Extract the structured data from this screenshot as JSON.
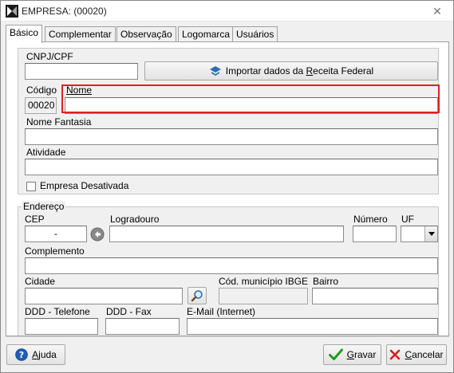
{
  "window": {
    "title": "EMPRESA: (00020)",
    "close_glyph": "✕"
  },
  "tabs": [
    {
      "label": "Básico",
      "active": true
    },
    {
      "label": "Complementar"
    },
    {
      "label": "Observação"
    },
    {
      "label": "Logomarca"
    },
    {
      "label": "Usuários"
    }
  ],
  "basic": {
    "cnpj_label": "CNPJ/CPF",
    "cnpj_value": "",
    "import_button": {
      "prefix": "Importar dados da ",
      "accel": "R",
      "suffix": "eceita Federal"
    },
    "codigo_label": "Código",
    "codigo_value": "00020",
    "nome_label": "Nome",
    "nome_value": "",
    "fantasia_label": "Nome Fantasia",
    "fantasia_value": "",
    "atividade_label": "Atividade",
    "atividade_value": "",
    "desativada_label": "Empresa Desativada",
    "desativada_checked": false
  },
  "address": {
    "legend": "Endereço",
    "cep_label": "CEP",
    "cep_value": "-",
    "logradouro_label": "Logradouro",
    "numero_label": "Número",
    "uf_label": "UF",
    "complemento_label": "Complemento",
    "cidade_label": "Cidade",
    "ibge_label": "Cód. município IBGE",
    "bairro_label": "Bairro",
    "ddd_tel_label": "DDD - Telefone",
    "ddd_fax_label": "DDD - Fax",
    "email_label": "E-Mail (Internet)"
  },
  "footer": {
    "help": {
      "accel": "A",
      "rest": "juda"
    },
    "save": {
      "accel": "G",
      "rest": "ravar"
    },
    "cancel": {
      "accel": "C",
      "rest": "ancelar"
    }
  },
  "colors": {
    "highlight": "#e02020",
    "save_check": "#1e9e1e",
    "cancel_x": "#d02020",
    "help_blue": "#1f5fb8"
  }
}
